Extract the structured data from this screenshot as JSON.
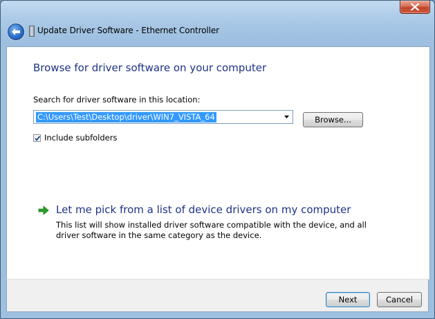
{
  "window": {
    "close_icon": "close-icon"
  },
  "header": {
    "back_icon": "back-arrow-icon",
    "device_icon": "network-adapter-icon",
    "title": "Update Driver Software - Ethernet Controller"
  },
  "main": {
    "heading": "Browse for driver software on your computer",
    "search_label": "Search for driver software in this location:",
    "path_value": "C:\\Users\\Test\\Desktop\\driver\\WIN7_VISTA_64",
    "browse_label": "Browse...",
    "include_subfolders_label": "Include subfolders",
    "include_subfolders_checked": true,
    "pick_link": "Let me pick from a list of device drivers on my computer",
    "pick_description": "This list will show installed driver software compatible with the device, and all driver software in the same category as the device."
  },
  "footer": {
    "next_label": "Next",
    "cancel_label": "Cancel"
  },
  "colors": {
    "heading": "#1e3287",
    "link_arrow": "#2aa02a",
    "selection": "#3399ff"
  }
}
